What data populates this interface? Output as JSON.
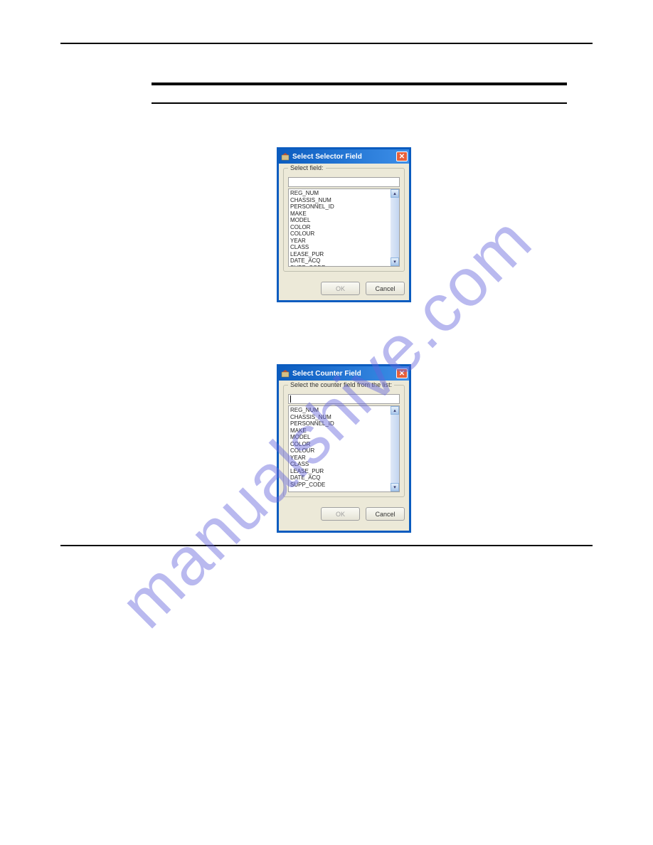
{
  "watermark": "manualshive.com",
  "dialog1": {
    "title": "Select Selector Field",
    "groupbox_label": "Select field:",
    "ok_label": "OK",
    "cancel_label": "Cancel",
    "items": [
      "REG_NUM",
      "CHASSIS_NUM",
      "PERSONNEL_ID",
      "MAKE",
      "MODEL",
      "COLOR",
      "COLOUR",
      "YEAR",
      "CLASS",
      "LEASE_PUR",
      "DATE_ACQ",
      "SUPP_CODE"
    ]
  },
  "dialog2": {
    "title": "Select Counter Field",
    "groupbox_label": "Select the counter field from the list:",
    "ok_label": "OK",
    "cancel_label": "Cancel",
    "items": [
      "REG_NUM",
      "CHASSIS_NUM",
      "PERSONNEL_ID",
      "MAKE",
      "MODEL",
      "COLOR",
      "COLOUR",
      "YEAR",
      "CLASS",
      "LEASE_PUR",
      "DATE_ACQ",
      "SUPP_CODE"
    ]
  }
}
